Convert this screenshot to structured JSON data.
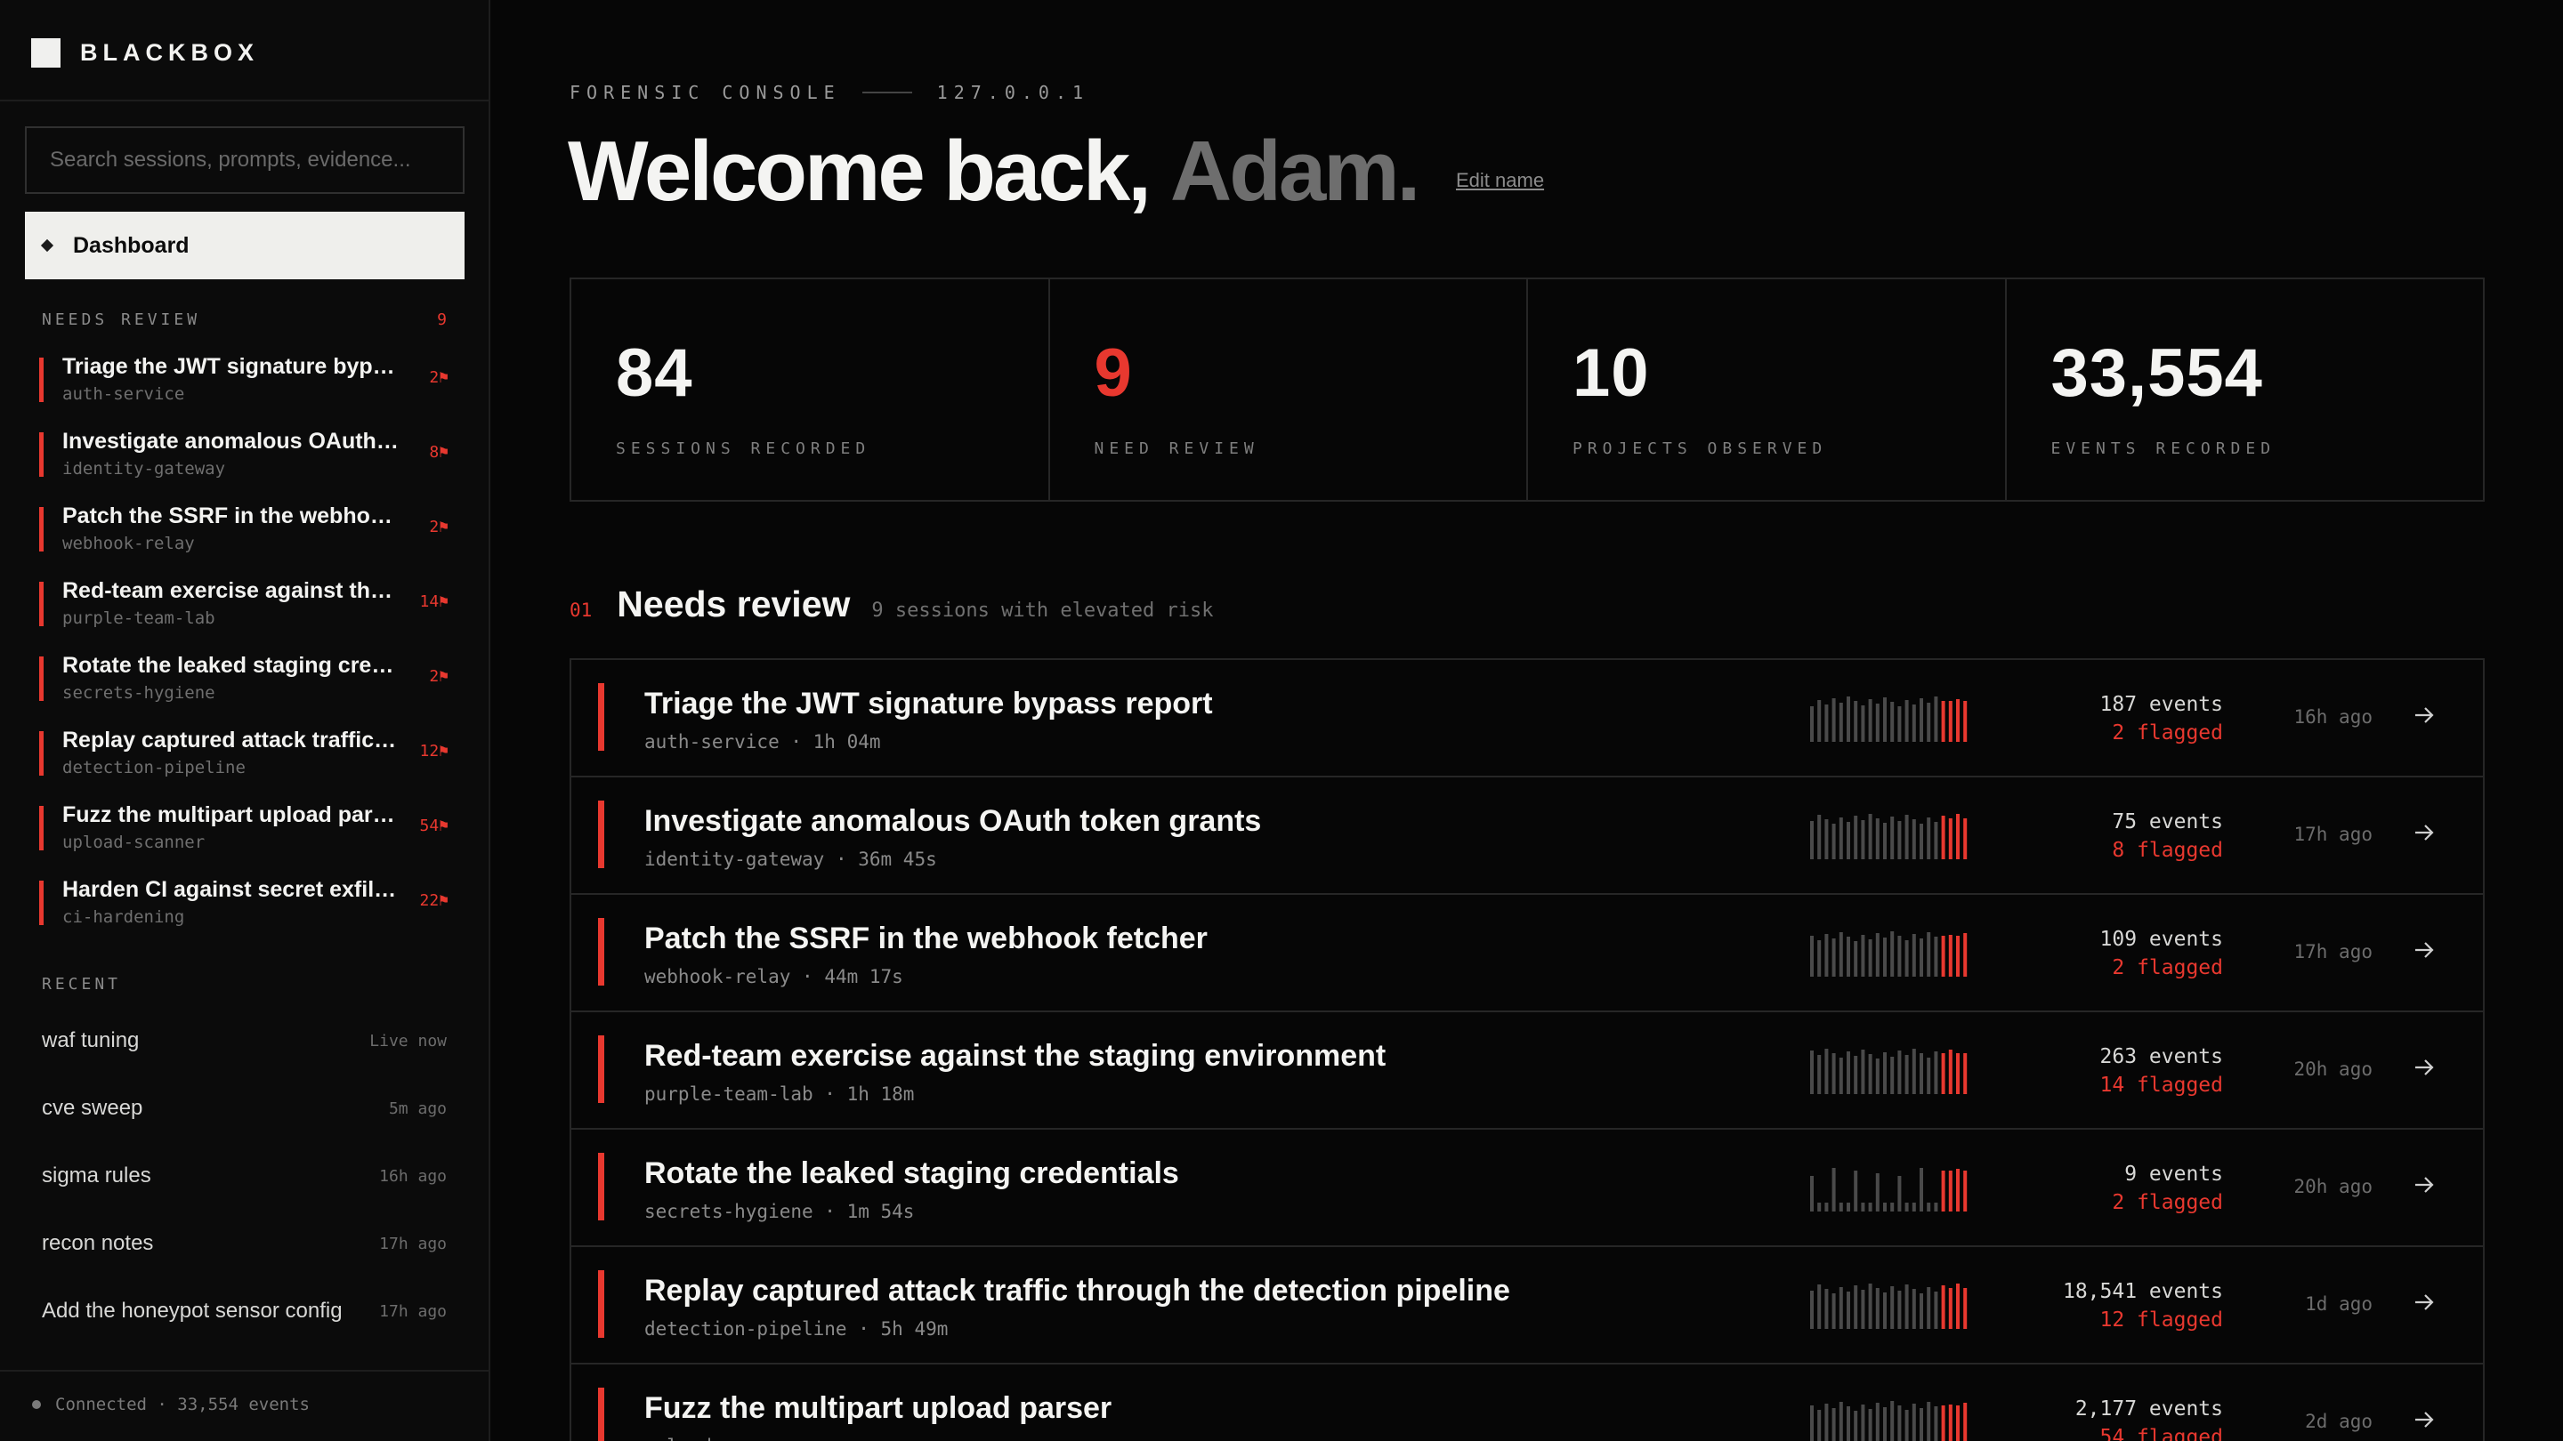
{
  "brand": {
    "name": "BLACKBOX"
  },
  "search": {
    "placeholder": "Search sessions, prompts, evidence..."
  },
  "nav": {
    "dashboard_label": "Dashboard"
  },
  "needs_review_sidebar": {
    "heading": "NEEDS REVIEW",
    "count": "9",
    "items": [
      {
        "title": "Triage the JWT signature bypass report",
        "project": "auth-service",
        "flags": "2⚑"
      },
      {
        "title": "Investigate anomalous OAuth token grants",
        "project": "identity-gateway",
        "flags": "8⚑"
      },
      {
        "title": "Patch the SSRF in the webhook fetcher",
        "project": "webhook-relay",
        "flags": "2⚑"
      },
      {
        "title": "Red-team exercise against the staging environment",
        "project": "purple-team-lab",
        "flags": "14⚑"
      },
      {
        "title": "Rotate the leaked staging credentials",
        "project": "secrets-hygiene",
        "flags": "2⚑"
      },
      {
        "title": "Replay captured attack traffic through the detection pipeline",
        "project": "detection-pipeline",
        "flags": "12⚑"
      },
      {
        "title": "Fuzz the multipart upload parser",
        "project": "upload-scanner",
        "flags": "54⚑"
      },
      {
        "title": "Harden CI against secret exfiltration",
        "project": "ci-hardening",
        "flags": "22⚑"
      }
    ]
  },
  "recent": {
    "heading": "RECENT",
    "items": [
      {
        "name": "waf tuning",
        "time": "Live now"
      },
      {
        "name": "cve sweep",
        "time": "5m ago"
      },
      {
        "name": "sigma rules",
        "time": "16h ago"
      },
      {
        "name": "recon notes",
        "time": "17h ago"
      },
      {
        "name": "Add the honeypot sensor config",
        "time": "17h ago"
      }
    ]
  },
  "footer": {
    "status": "Connected · 33,554 events"
  },
  "header": {
    "eyebrow_left": "FORENSIC CONSOLE",
    "eyebrow_right": "127.0.0.1",
    "welcome": "Welcome back,",
    "user_name": "Adam.",
    "edit_name": "Edit name"
  },
  "stats": [
    {
      "value": "84",
      "label": "SESSIONS RECORDED",
      "highlight": false
    },
    {
      "value": "9",
      "label": "NEED REVIEW",
      "highlight": true
    },
    {
      "value": "10",
      "label": "PROJECTS OBSERVED",
      "highlight": false
    },
    {
      "value": "33,554",
      "label": "EVENTS RECORDED",
      "highlight": false
    }
  ],
  "section": {
    "index": "01",
    "title": "Needs review",
    "description": "9 sessions with elevated risk"
  },
  "sessions": [
    {
      "title": "Triage the JWT signature bypass report",
      "project": "auth-service",
      "duration": "1h 04m",
      "events": "187 events",
      "flagged": "2 flagged",
      "ago": "16h ago"
    },
    {
      "title": "Investigate anomalous OAuth token grants",
      "project": "identity-gateway",
      "duration": "36m 45s",
      "events": "75 events",
      "flagged": "8 flagged",
      "ago": "17h ago"
    },
    {
      "title": "Patch the SSRF in the webhook fetcher",
      "project": "webhook-relay",
      "duration": "44m 17s",
      "events": "109 events",
      "flagged": "2 flagged",
      "ago": "17h ago"
    },
    {
      "title": "Red-team exercise against the staging environment",
      "project": "purple-team-lab",
      "duration": "1h 18m",
      "events": "263 events",
      "flagged": "14 flagged",
      "ago": "20h ago"
    },
    {
      "title": "Rotate the leaked staging credentials",
      "project": "secrets-hygiene",
      "duration": "1m 54s",
      "events": "9 events",
      "flagged": "2 flagged",
      "ago": "20h ago"
    },
    {
      "title": "Replay captured attack traffic through the detection pipeline",
      "project": "detection-pipeline",
      "duration": "5h 49m",
      "events": "18,541 events",
      "flagged": "12 flagged",
      "ago": "1d ago"
    },
    {
      "title": "Fuzz the multipart upload parser",
      "project": "upload-scanner",
      "duration": "",
      "events": "2,177 events",
      "flagged": "54 flagged",
      "ago": "2d ago"
    }
  ],
  "colors": {
    "accent": "#e8382f",
    "background": "#060606",
    "sidebar": "#0b0b0b",
    "muted_bar": "#4a4a4a"
  }
}
